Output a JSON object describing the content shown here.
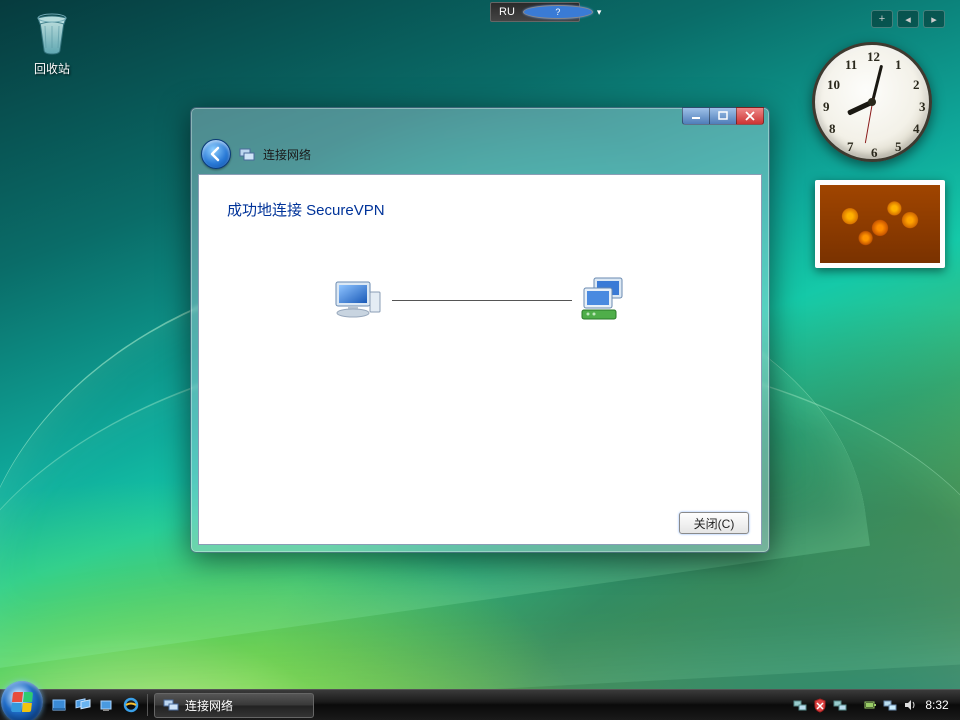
{
  "desktop": {
    "recycle_bin_label": "回收站"
  },
  "langbar": {
    "lang": "RU"
  },
  "gadgets": {
    "plus": "+",
    "left": "◂",
    "right": "▸"
  },
  "clock": {
    "n12": "12",
    "n1": "1",
    "n2": "2",
    "n3": "3",
    "n4": "4",
    "n5": "5",
    "n6": "6",
    "n7": "7",
    "n8": "8",
    "n9": "9",
    "n10": "10",
    "n11": "11"
  },
  "window": {
    "nav_title": "连接网络",
    "heading": "成功地连接 SecureVPN",
    "close_btn": "关闭(C)"
  },
  "taskbar": {
    "task1_label": "连接网络",
    "clock": "8:32"
  }
}
